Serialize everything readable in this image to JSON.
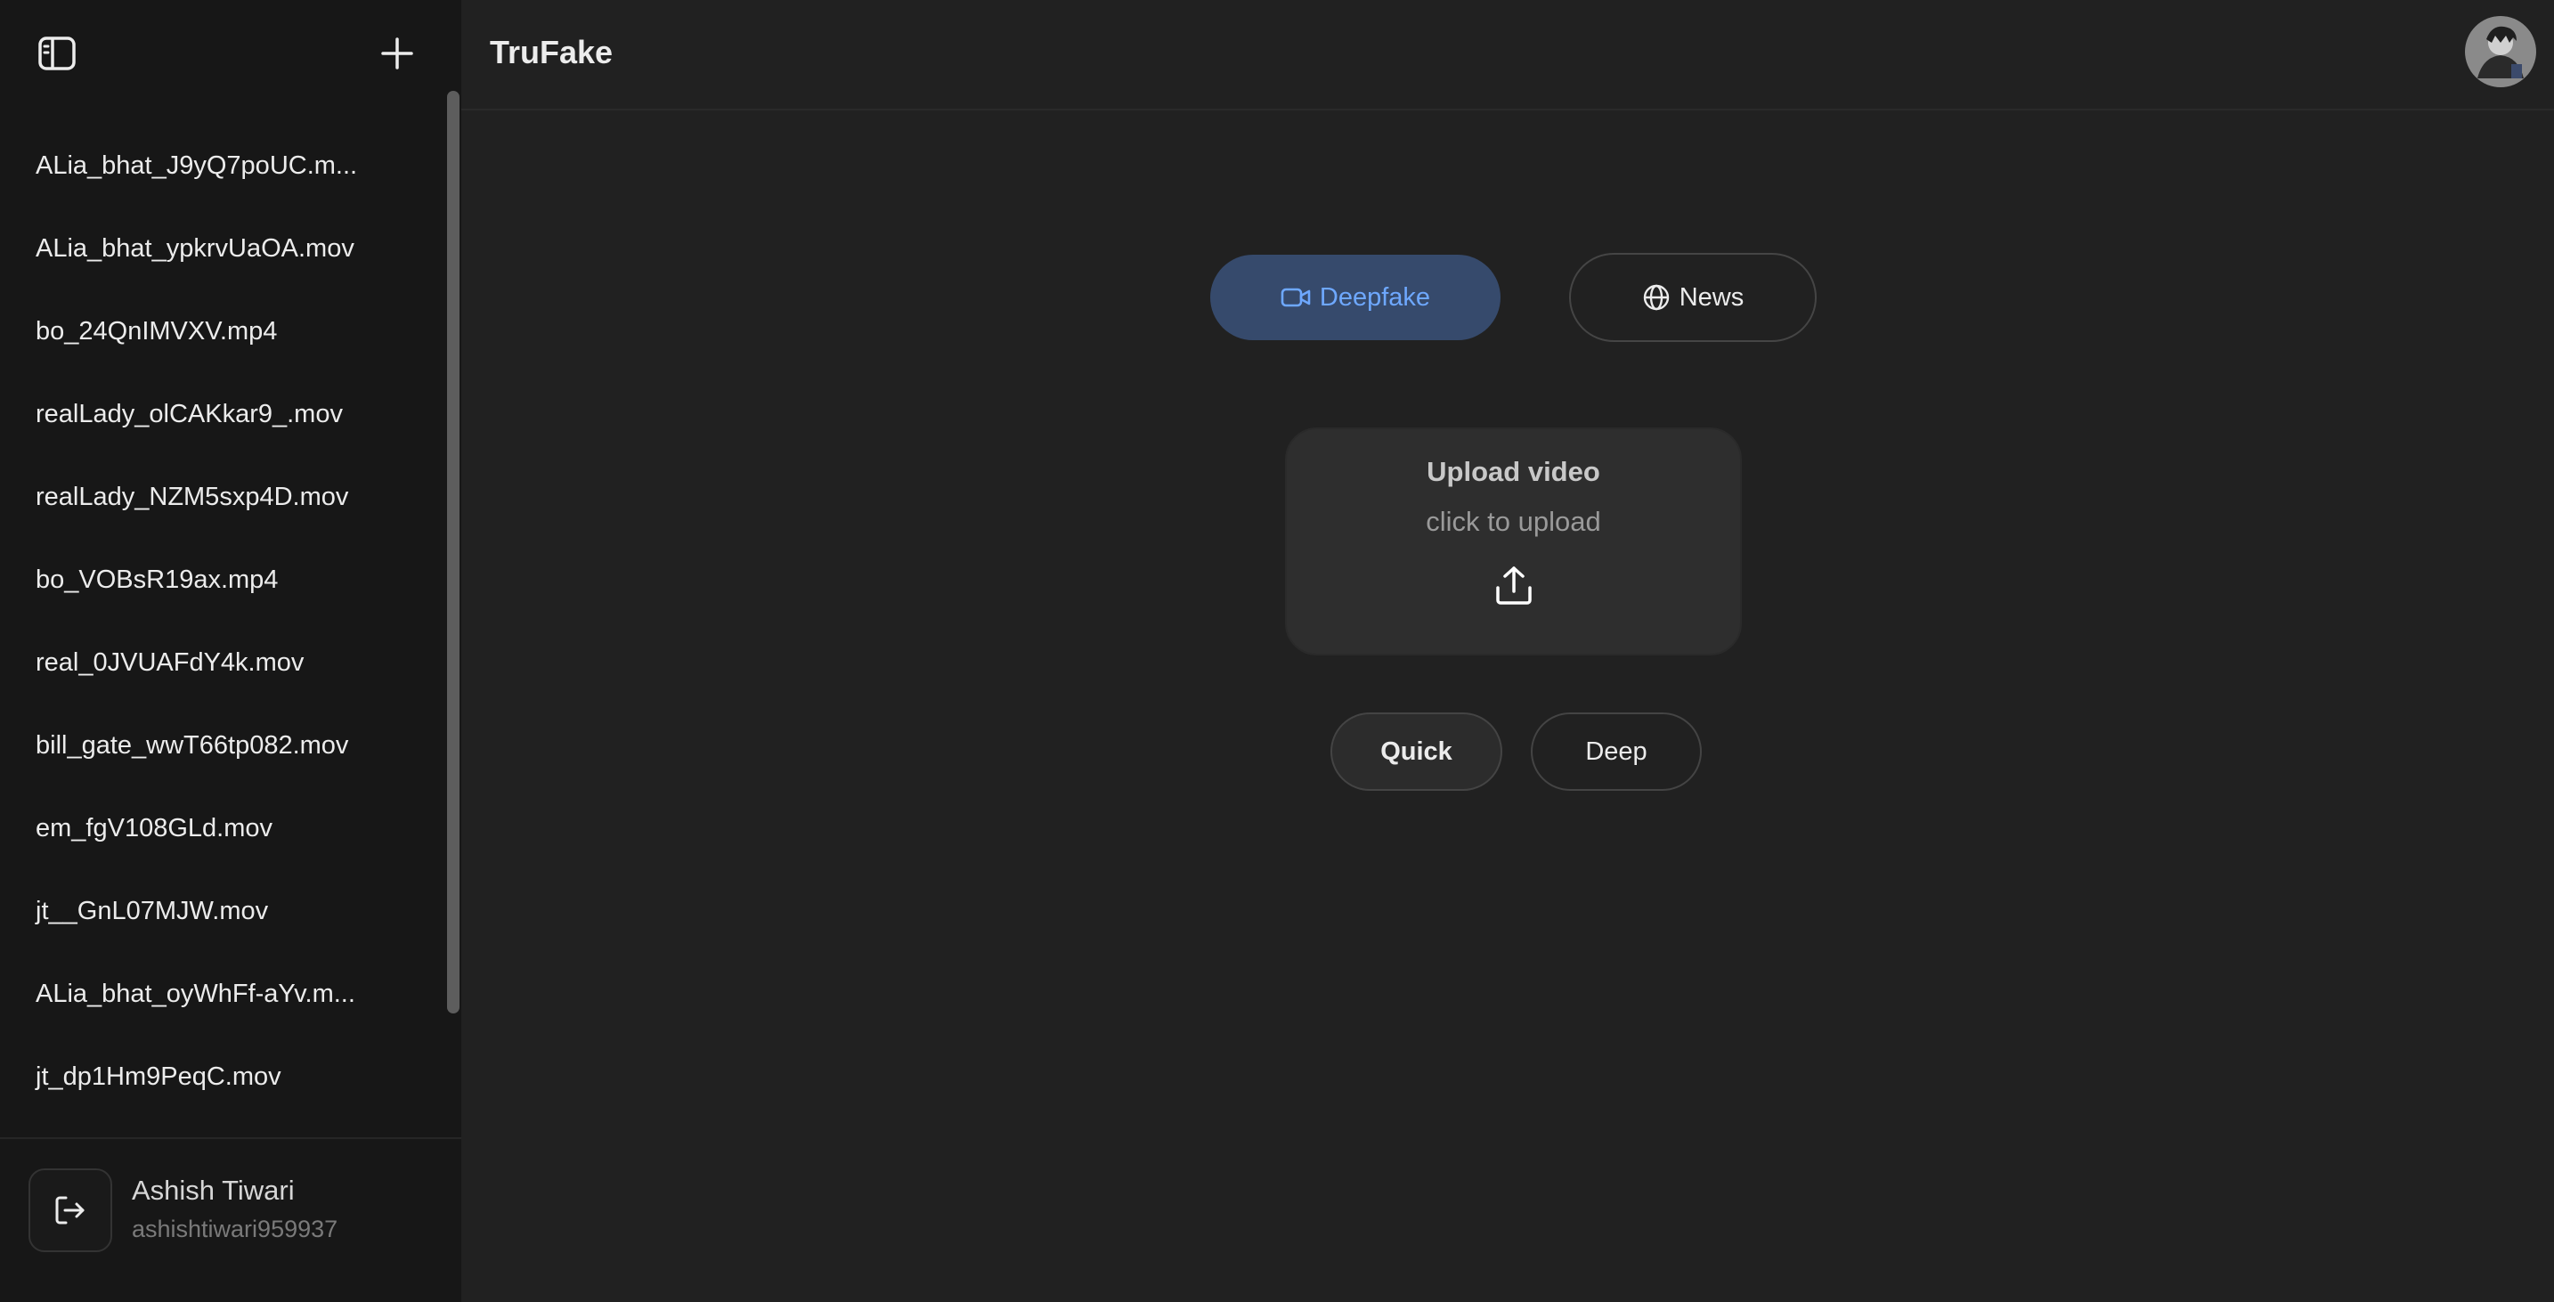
{
  "app": {
    "title": "TruFake"
  },
  "sidebar": {
    "toggle_icon": "sidebar-toggle-icon",
    "new_icon": "plus-icon",
    "history": [
      "ALia_bhat_J9yQ7poUC.m...",
      "ALia_bhat_ypkrvUaOA.mov",
      "bo_24QnIMVXV.mp4",
      "realLady_olCAKkar9_.mov",
      "realLady_NZM5sxp4D.mov",
      "bo_VOBsR19ax.mp4",
      "real_0JVUAFdY4k.mov",
      "bill_gate_wwT66tp082.mov",
      "em_fgV108GLd.mov",
      "jt__GnL07MJW.mov",
      "ALia_bhat_oyWhFf-aYv.m...",
      "jt_dp1Hm9PeqC.mov"
    ],
    "user": {
      "name": "Ashish Tiwari",
      "handle": "ashishtiwari959937"
    }
  },
  "mode_tabs": {
    "deepfake": "Deepfake",
    "news": "News",
    "active": "deepfake"
  },
  "upload": {
    "title": "Upload video",
    "subtitle": "click to upload"
  },
  "depth": {
    "quick": "Quick",
    "deep": "Deep",
    "active": "quick"
  },
  "colors": {
    "accent": "#6ea8ff",
    "accent_bg": "#364a6c",
    "sidebar_bg": "#171717",
    "main_bg": "#212121"
  }
}
